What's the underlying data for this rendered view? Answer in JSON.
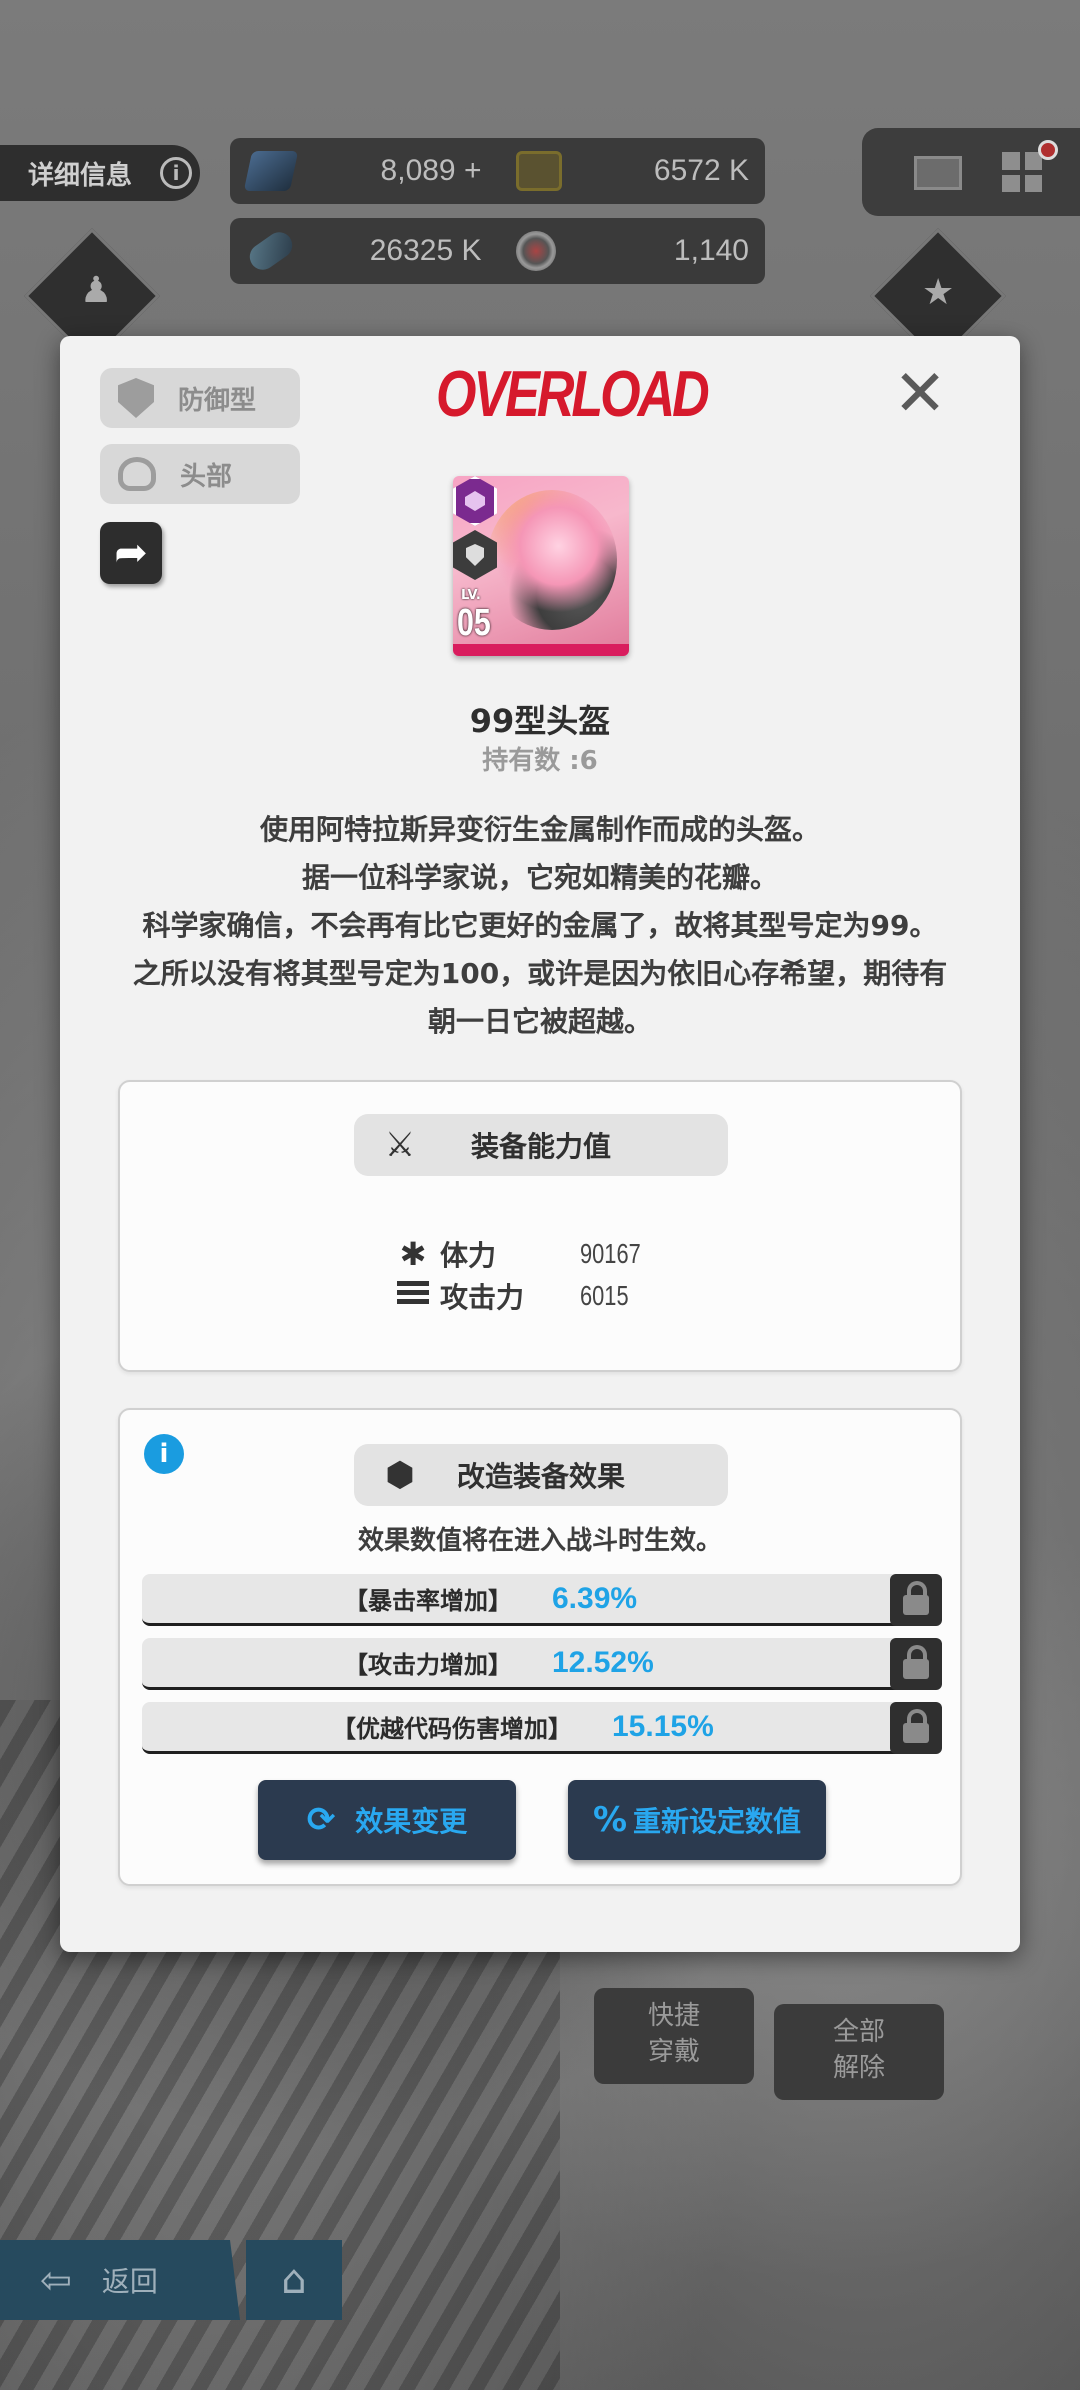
{
  "hud": {
    "detail_label": "详细信息",
    "info_icon": "i",
    "resources_row1": [
      {
        "icon": "gem-icon",
        "value": "8,089",
        "suffix": "+"
      },
      {
        "icon": "credit-card-icon",
        "value": "6572 K",
        "suffix": ""
      }
    ],
    "resources_row2": [
      {
        "icon": "core-dust-icon",
        "value": "26325 K",
        "suffix": ""
      },
      {
        "icon": "body-core-icon",
        "value": "1,140",
        "suffix": ""
      }
    ]
  },
  "background": {
    "quick_equip_label": "快捷\n穿戴",
    "remove_all_label": "全部\n解除",
    "back_label": "返回"
  },
  "modal": {
    "brand": "OVERLOAD",
    "class_tag": "防御型",
    "slot_tag": "头部",
    "level_prefix": "LV.",
    "level": "05",
    "item_name": "99型头盔",
    "owned_count": "持有数 :6",
    "description": [
      "使用阿特拉斯异变衍生金属制作而成的头盔。",
      "据一位科学家说，它宛如精美的花瓣。",
      "科学家确信，不会再有比它更好的金属了，故将其型号定为99。",
      "之所以没有将其型号定为100，或许是因为依旧心存希望，期待有",
      "朝一日它被超越。"
    ],
    "stats_panel": {
      "title": "装备能力值",
      "stats": [
        {
          "label": "体力",
          "value": "90167"
        },
        {
          "label": "攻击力",
          "value": "6015"
        }
      ]
    },
    "effects_panel": {
      "title": "改造装备效果",
      "hint": "效果数值将在进入战斗时生效。",
      "effects": [
        {
          "name": "【暴击率增加】",
          "value": "6.39%"
        },
        {
          "name": "【攻击力增加】",
          "value": "12.52%"
        },
        {
          "name": "【优越代码伤害增加】",
          "value": "15.15%"
        }
      ],
      "change_button": "效果变更",
      "reset_button": "重新设定数值"
    }
  },
  "colors": {
    "accent_blue": "#29a8f0",
    "brand_red": "#d6192c",
    "card_pink": "#f7a4c4"
  }
}
